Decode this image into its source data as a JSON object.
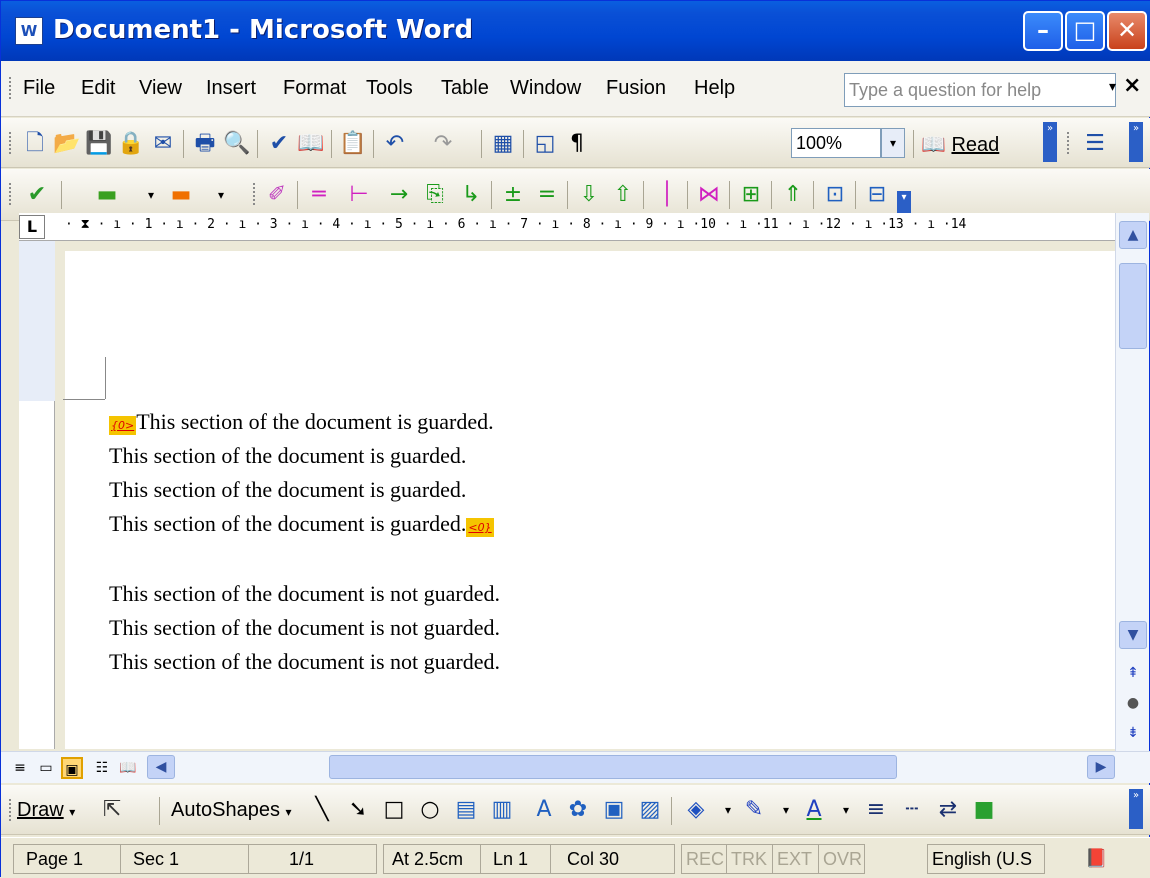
{
  "window": {
    "title": "Document1 - Microsoft Word",
    "app_icon": "W",
    "minimize": "–",
    "maximize": "□",
    "close": "✕"
  },
  "menu": {
    "items": [
      "File",
      "Edit",
      "View",
      "Insert",
      "Format",
      "Tools",
      "Table",
      "Window",
      "Fusion",
      "Help"
    ],
    "help_placeholder": "Type a question for help",
    "help_dropdown": "▾",
    "close_doc": "×"
  },
  "standard_toolbar": {
    "new": "🗋",
    "open": "📂",
    "save": "💾",
    "permission": "🔒",
    "email": "✉",
    "print": "🖶",
    "print_preview": "🔍",
    "spelling": "✔",
    "research": "📖",
    "paste": "📋",
    "undo": "↶",
    "redo": "↷",
    "table": "▦",
    "drawing": "◱",
    "pilcrow": "¶",
    "zoom": "100%",
    "zoom_dd": "▾",
    "read": "Read",
    "read_icon": "📖",
    "bullets": "☰"
  },
  "fusion_toolbar": {
    "icons": [
      "✔",
      "▬",
      "▾",
      "▬",
      "▾",
      "✐",
      "═",
      "⊢",
      "→",
      "⎘",
      "↳",
      "±",
      "=",
      "⇩",
      "⇧",
      "│",
      "⋈",
      "⊞",
      "⇑",
      "⊡",
      "⊟"
    ]
  },
  "ruler": {
    "corner": "L",
    "numbers": "· ⧗ · ı · 1 · ı · 2 · ı · 3 · ı · 4 · ı · 5 · ı · 6 · ı · 7 · ı · 8 · ı · 9 · ı ·10 · ı ·11 · ı ·12 · ı ·13 · ı ·14"
  },
  "document": {
    "guard_open": "{0>",
    "guard_close": "<0}",
    "lines": [
      "This section of the document is guarded.",
      "This section of the document is guarded.",
      "This section of the document is guarded.",
      "This section of the document is guarded.",
      "This section of the document is not guarded.",
      "This section of the document is not guarded.",
      "This section of the document is not guarded."
    ]
  },
  "scroll": {
    "up": "▲",
    "down": "▼",
    "left": "◀",
    "right": "▶",
    "prev_page": "⇞",
    "select_browse": "●",
    "next_page": "⇟",
    "thumb_grip": "≡"
  },
  "views": {
    "normal": "≡",
    "web": "▭",
    "print": "▣",
    "outline": "☷",
    "reading": "📖"
  },
  "drawing_toolbar": {
    "draw": "Draw",
    "draw_dd": "▾",
    "autoshapes": "AutoShapes",
    "autoshapes_dd": "▾",
    "icons": [
      "⇱",
      "╲",
      "➘",
      "□",
      "○",
      "▤",
      "▥",
      "A",
      "✿",
      "▣",
      "▨",
      "◈",
      "▾",
      "✎",
      "▾",
      "A",
      "▾",
      "≡",
      "┄",
      "⇄",
      "■"
    ]
  },
  "statusbar": {
    "page": "Page 1",
    "sec": "Sec 1",
    "pages": "1/1",
    "at": "At 2.5cm",
    "ln": "Ln 1",
    "col": "Col 30",
    "rec": "REC",
    "trk": "TRK",
    "ext": "EXT",
    "ovr": "OVR",
    "language": "English (U.S",
    "spell_icon": "📕"
  }
}
